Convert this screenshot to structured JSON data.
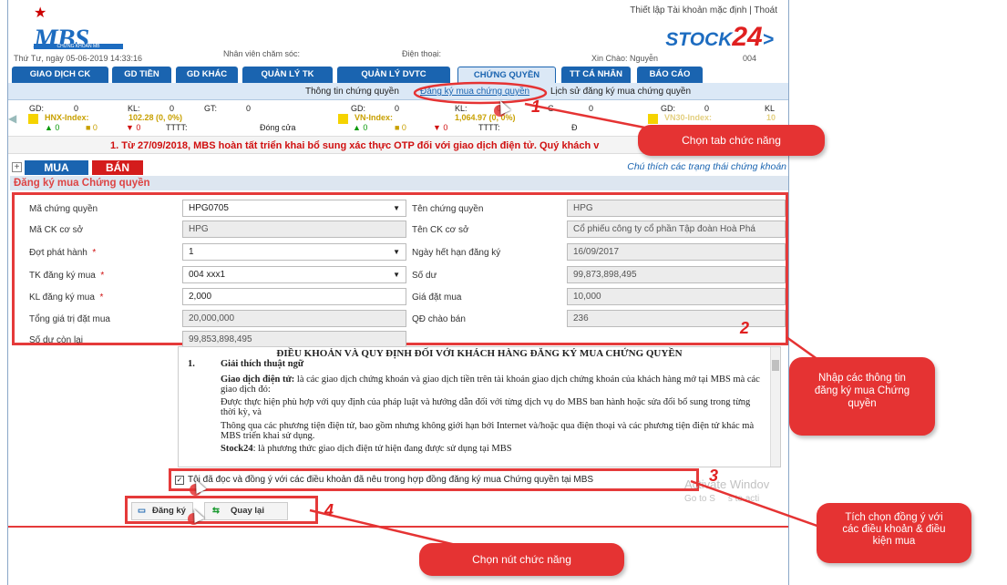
{
  "brand": {
    "logo_text": "MBS",
    "logo_sub": "CHỨNG KHOÁN MB",
    "stock24_a": "STOCK",
    "stock24_b": "24"
  },
  "toplinks": "Thiết lập Tài khoản mặc định | Thoát",
  "infobar": {
    "date": "Thứ Tư, ngày 05-06-2019 14:33:16",
    "staff": "Nhân viên chăm sóc:",
    "phone": "Điện thoại:",
    "greeting": "Xin Chào: Nguyễn",
    "code": "004"
  },
  "tabs": [
    "GIAO DỊCH CK",
    "GD TIỀN",
    "GD KHÁC",
    "QUẢN LÝ TK",
    "QUẢN LÝ DVTC",
    "CHỨNG QUYỀN",
    "TT CÁ NHÂN",
    "BÁO CÁO"
  ],
  "subtabs": {
    "info": "Thông tin chứng quyền",
    "register": "Đăng ký mua chứng quyền",
    "history": "Lịch sử đăng ký mua chứng quyền"
  },
  "ticker": {
    "gd": "GD:",
    "kl": "KL:",
    "gt": "GT:",
    "zero": "0",
    "tttt": "TTTT:",
    "close": "Đóng cửa",
    "d": "Đ",
    "hnx": "HNX-Index:",
    "hnx_val": "102.28 (0, 0%)",
    "vn": "VN-Index:",
    "vn_val": "1,064.97 (0, 0%)",
    "vn30": "VN30-Index:",
    "vn30_val": "10",
    "up0": "▲ 0",
    "eq0": "■ 0",
    "dn0": "▼ 0",
    "g": "G",
    "kl2": "KL"
  },
  "alert": "1. Từ 27/09/2018, MBS hoàn tất triển khai bổ sung xác thực OTP đối với giao dịch điện tử. Quý khách v",
  "actions": {
    "mua": "MUA",
    "ban": "BÁN",
    "legend": "Chú thích các trạng thái chứng khoán"
  },
  "section_title": "Đăng ký mua Chứng quyền",
  "form": {
    "ma_cq_label": "Mã chứng quyền",
    "ma_cq": "HPG0705",
    "ten_cq_label": "Tên chứng quyền",
    "ten_cq": "HPG",
    "ma_ck_label": "Mã CK cơ sở",
    "ma_ck": "HPG",
    "ten_ck_label": "Tên CK cơ sở",
    "ten_ck": "Cổ phiếu công ty cổ phần Tập đoàn Hoà Phá",
    "dot_label": "Đợt phát hành",
    "dot": "1",
    "ngay_label": "Ngày hết hạn đăng ký",
    "ngay": "16/09/2017",
    "tk_label": "TK đăng ký mua",
    "tk": "004 xxx1",
    "sodu_label": "Số dư",
    "sodu": "99,873,898,495",
    "kl_label": "KL đăng ký mua",
    "kl": "2,000",
    "gia_label": "Giá đặt mua",
    "gia": "10,000",
    "tong_label": "Tổng giá trị đặt mua",
    "tong": "20,000,000",
    "qd_label": "QĐ chào bán",
    "qd": "236",
    "con_label": "Số dư còn lại",
    "con": "99,853,898,495",
    "star": "*"
  },
  "terms": {
    "title": "ĐIỀU KHOẢN VÀ QUY ĐỊNH ĐỐI VỚI KHÁCH HÀNG ĐĂNG KÝ MUA CHỨNG QUYỀN",
    "num": "1.",
    "sub": "Giải thích thuật ngữ",
    "p1_b": "Giao dịch điện tử:",
    "p1": " là các giao dịch chứng khoán và giao dịch tiền trên tài khoản giao dịch chứng khoán của khách hàng mở tại MBS mà các giao dịch đó:",
    "p2": "Được thực hiện phù hợp với quy định của pháp luật và hướng dẫn đối với từng dịch vụ do MBS ban hành hoặc sửa đổi bổ sung trong từng thời kỳ, và",
    "p3": "Thông qua các phương tiện điện tử, bao gồm nhưng không giới hạn bởi Internet và/hoặc qua điện thoại và các phương tiện điện tử khác mà MBS triển khai sử dụng.",
    "p4_b": "Stock24",
    "p4": ": là phương thức giao dịch điện tử hiện đang được sử dụng tại MBS"
  },
  "agree": "Tôi đã đọc và đồng ý với các điều khoản đã nêu trong hợp đồng đăng ký mua Chứng quyền tại MBS",
  "buttons": {
    "register": "Đăng ký",
    "back": "Quay lại"
  },
  "watermark": {
    "line1": "Activate Windov",
    "line2": "Go to S",
    "line3": "s to acti"
  },
  "callouts": {
    "c1": "Chọn tab chức năng",
    "c2": "Nhập các thông tin đăng ký mua Chứng quyền",
    "c3": "Tích chọn đồng ý với các điều khoản & điều kiện mua",
    "c4": "Chọn nút chức năng"
  },
  "steps": {
    "s1": "1",
    "s2": "2",
    "s3": "3",
    "s4": "4"
  },
  "colors": {
    "brand_blue": "#1a64b0",
    "accent_red": "#e53333",
    "index_yellow": "#f5d300"
  }
}
